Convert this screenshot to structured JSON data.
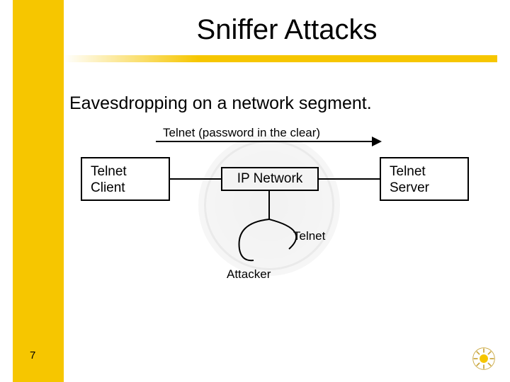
{
  "slide": {
    "title": "Sniffer Attacks",
    "subtitle": "Eavesdropping on a network segment.",
    "page_number": "7"
  },
  "diagram": {
    "arrow_label": "Telnet (password in the clear)",
    "client_box_l1": "Telnet",
    "client_box_l2": "Client",
    "ip_box": "IP Network",
    "server_box_l1": "Telnet",
    "server_box_l2": "Server",
    "branch_label": "Telnet",
    "attacker_label": "Attacker"
  },
  "icons": {
    "logo": "sun-logo"
  }
}
